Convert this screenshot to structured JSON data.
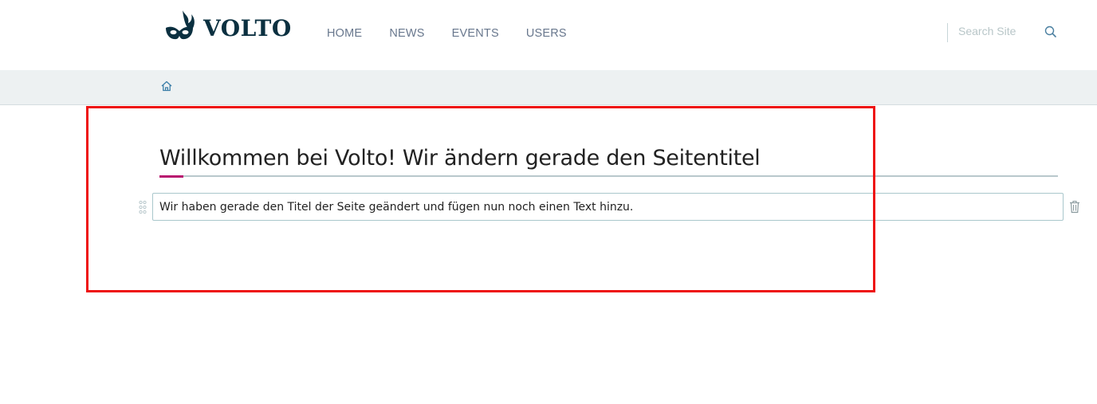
{
  "brand": {
    "name": "VOLTO",
    "logo_icon": "volto-mask-icon",
    "color": "#0b3040"
  },
  "nav": {
    "items": [
      {
        "label": "HOME"
      },
      {
        "label": "NEWS"
      },
      {
        "label": "EVENTS"
      },
      {
        "label": "USERS"
      }
    ]
  },
  "search": {
    "placeholder": "Search Site",
    "value": "",
    "icon": "search-icon"
  },
  "breadcrumb": {
    "home_icon": "home-icon"
  },
  "content": {
    "title": "Willkommen bei Volto! Wir ändern gerade den Seitentitel",
    "text_block": "Wir haben gerade den Titel der Seite geändert und fügen nun noch einen Text hinzu.",
    "drag_icon": "drag-handle-icon",
    "delete_icon": "trash-icon"
  },
  "colors": {
    "accent": "#b8106e",
    "highlight": "#ee1111",
    "breadcrumb_bg": "#edf1f2",
    "nav_text": "#68778d"
  }
}
